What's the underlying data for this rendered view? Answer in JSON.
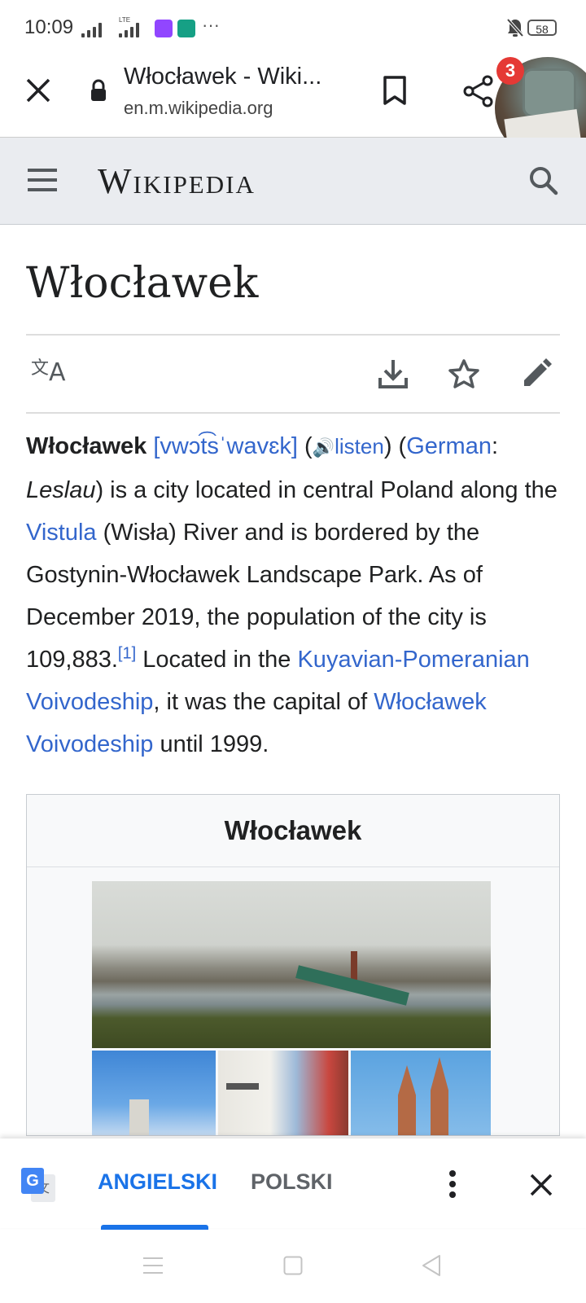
{
  "status_bar": {
    "time": "10:09",
    "lte": "LTE",
    "more": "···",
    "battery": "58"
  },
  "browser": {
    "tab_title": "Włocławek - Wiki...",
    "url": "en.m.wikipedia.org",
    "badge_count": "3"
  },
  "wiki": {
    "wordmark": "Wikipedia",
    "page_title": "Włocławek"
  },
  "article": {
    "bold_name": "Włocławek",
    "ipa": "[vwɔt͡sˈwavɛk]",
    "listen": "listen",
    "german": "German",
    "leslau": "Leslau",
    "t1": ") is a city located in central Poland along the ",
    "vistula": "Vistula",
    "t2": " (Wisła) River and is bordered by the Gostynin-Włocławek Landscape Park. As of December 2019, the population of the city is 109,883.",
    "ref": "[1]",
    "t3": " Located in the ",
    "kuyavian": "Kuyavian-Pomeranian Voivodeship",
    "t4": ", it was the capital of ",
    "wloclawek_voiv": "Włocławek Voivodeship",
    "t5": " until 1999."
  },
  "infobox": {
    "title": "Włocławek"
  },
  "translate_bar": {
    "lang_selected": "ANGIELSKI",
    "lang_other": "POLSKI"
  },
  "colors": {
    "link": "#3366cc",
    "header_bg": "#eaecf0",
    "translate_accent": "#1a73e8"
  }
}
